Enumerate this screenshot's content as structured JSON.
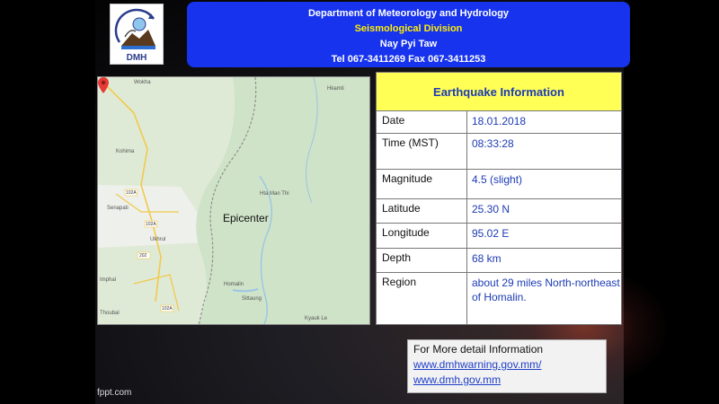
{
  "header": {
    "line1": "Department of Meteorology and Hydrology",
    "line2": "Seismological Division",
    "line3": "Nay Pyi Taw",
    "line4": "Tel 067-3411269 Fax 067-3411253"
  },
  "logo": {
    "text": "DMH"
  },
  "map": {
    "epicenter_label": "Epicenter",
    "places": [
      "Wokha",
      "Kohima",
      "Hkamti",
      "Hta Man Thi",
      "Senapati",
      "Ukhrul",
      "Homalin",
      "Imphal",
      "Thoubal",
      "Sittaung",
      "Kyauk Le"
    ],
    "road_numbers": [
      "102A",
      "102A",
      "202",
      "102A"
    ]
  },
  "info": {
    "title": "Earthquake Information",
    "rows": [
      {
        "label": "Date",
        "value": "18.01.2018"
      },
      {
        "label": "Time (MST)",
        "value": "08:33:28"
      },
      {
        "label": "Magnitude",
        "value": "4.5 (slight)"
      },
      {
        "label": "Latitude",
        "value": "25.30 N"
      },
      {
        "label": "Longitude",
        "value": "95.02 E"
      },
      {
        "label": "Depth",
        "value": "68 km"
      },
      {
        "label": "Region",
        "value": "about 29 miles North-northeast of  Homalin."
      }
    ]
  },
  "more": {
    "heading": "For More detail Information",
    "link1": "www.dmhwarning.gov.mm/",
    "link2": "www.dmh.gov.mm"
  },
  "footer": {
    "text": "fppt.com"
  },
  "colors": {
    "header_bg": "#1733ee",
    "title_bg": "#ffff55",
    "value_text": "#1c3bb4",
    "pin": "#e53935"
  }
}
